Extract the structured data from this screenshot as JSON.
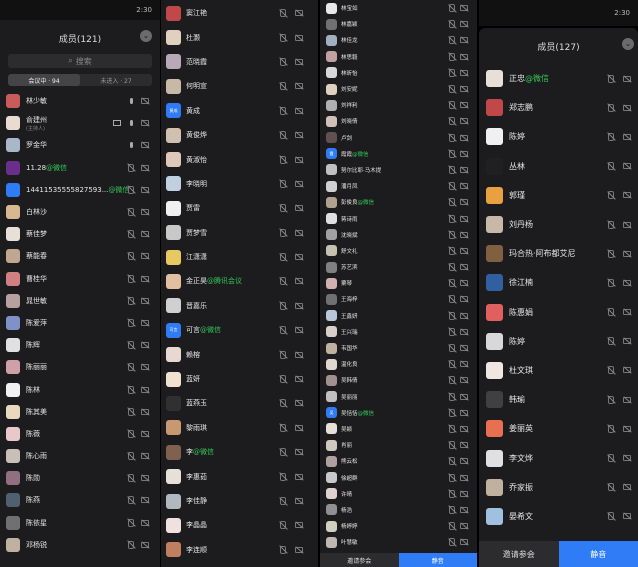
{
  "panel1": {
    "status_time": "2:30",
    "title": "成员(121)",
    "search_placeholder": "搜索",
    "tab_in_meeting": "会议中 · 94",
    "tab_not_joined": "未进入 · 27",
    "members": [
      {
        "name": "林少敏",
        "color": "#c95b5b",
        "mic": "mic-on"
      },
      {
        "name": "俞建州",
        "sub": "(主持人)",
        "color": "#e8dcd0",
        "mic": "mic-on",
        "screen": true
      },
      {
        "name": "罗金华",
        "color": "#a8b8c8",
        "mic": "mic-on"
      },
      {
        "name": "11.28",
        "tag": "@微信",
        "color": "#6a2f8a"
      },
      {
        "name": "14411535555827593...",
        "tag": "@微信",
        "color": "#2f7cf6"
      },
      {
        "name": "白林沙",
        "color": "#d8b890"
      },
      {
        "name": "蔡佳梦",
        "color": "#e8e0d8"
      },
      {
        "name": "蔡能春",
        "color": "#c0a890"
      },
      {
        "name": "曹桂华",
        "color": "#d08080"
      },
      {
        "name": "晁世敏",
        "color": "#b8a0a0"
      },
      {
        "name": "陈爱萍",
        "color": "#8090c8"
      },
      {
        "name": "陈辉",
        "color": "#e0e0e0"
      },
      {
        "name": "陈丽丽",
        "color": "#d0a0a8"
      },
      {
        "name": "陈林",
        "color": "#f0f0f0"
      },
      {
        "name": "陈其美",
        "color": "#e8d8c0"
      },
      {
        "name": "陈薇",
        "color": "#e8c8c8"
      },
      {
        "name": "陈心雨",
        "color": "#c8c0b8"
      },
      {
        "name": "陈勋",
        "color": "#907080"
      },
      {
        "name": "陈燕",
        "color": "#506070"
      },
      {
        "name": "陈依星",
        "color": "#707070"
      },
      {
        "name": "邓杨锐",
        "color": "#c0b0a0"
      }
    ]
  },
  "panel2": {
    "members": [
      {
        "name": "窦江艳",
        "color": "#c04848"
      },
      {
        "name": "杜灏",
        "color": "#e0d0c0"
      },
      {
        "name": "范晓霞",
        "color": "#b8a8b8"
      },
      {
        "name": "何明宣",
        "color": "#c8b8a8"
      },
      {
        "name": "黄成",
        "color": "#2f7cf6",
        "text": "黄成"
      },
      {
        "name": "黄俊烨",
        "color": "#d0c0b0"
      },
      {
        "name": "黄淑怡",
        "color": "#e0c8b8"
      },
      {
        "name": "李晓明",
        "color": "#c0d0e0"
      },
      {
        "name": "贾雷",
        "color": "#f0f0f0"
      },
      {
        "name": "贾梦雪",
        "color": "#c8c8c8"
      },
      {
        "name": "江潇潇",
        "color": "#e8c860"
      },
      {
        "name": "金正昊",
        "tag": "@腾讯会议",
        "color": "#e0c0a0"
      },
      {
        "name": "晋嘉乐",
        "color": "#d0d0d0"
      },
      {
        "name": "可言",
        "tag": "@微信",
        "color": "#2f7cf6",
        "text": "可言"
      },
      {
        "name": "赖榕",
        "color": "#e8d8d0"
      },
      {
        "name": "蓝妍",
        "color": "#f0e0d0"
      },
      {
        "name": "蓝燕玉",
        "color": "#303030"
      },
      {
        "name": "黎雨琪",
        "color": "#c89870"
      },
      {
        "name": "李",
        "tag": "@微信",
        "color": "#806050"
      },
      {
        "name": "李惠茹",
        "color": "#e8e0d8"
      },
      {
        "name": "李佳静",
        "color": "#b0b8c0"
      },
      {
        "name": "李晶晶",
        "color": "#f0e0e0"
      },
      {
        "name": "李连顺",
        "color": "#c08060"
      }
    ]
  },
  "panel3": {
    "members": [
      {
        "name": "林宝如",
        "color": "#e8e8e8"
      },
      {
        "name": "林嘉颖",
        "color": "#707070"
      },
      {
        "name": "林佳龙",
        "color": "#a0b0c0"
      },
      {
        "name": "林思毅",
        "color": "#c0a0a0"
      },
      {
        "name": "林昕怡",
        "color": "#d8d8d8"
      },
      {
        "name": "刘安妮",
        "color": "#e0d0c0"
      },
      {
        "name": "刘祥利",
        "color": "#b0b0b0"
      },
      {
        "name": "刘晓倩",
        "color": "#d0c0b8"
      },
      {
        "name": "卢剑",
        "color": "#605050"
      },
      {
        "name": "霞霞",
        "tag": "@微信",
        "color": "#2f7cf6",
        "text": "霞"
      },
      {
        "name": "努尔比耶·马木提",
        "color": "#c0c0c0"
      },
      {
        "name": "潘月凤",
        "color": "#d0d0d0"
      },
      {
        "name": "彭俊良",
        "tag": "@微信",
        "color": "#b0a090"
      },
      {
        "name": "蒋诗雨",
        "color": "#e0e0e0"
      },
      {
        "name": "沈晓斌",
        "color": "#a0a0a0"
      },
      {
        "name": "舒文礼",
        "color": "#c8c0b0"
      },
      {
        "name": "苏艺滨",
        "color": "#808080"
      },
      {
        "name": "粟琴",
        "color": "#d0b0b0"
      },
      {
        "name": "王海梓",
        "color": "#707070"
      },
      {
        "name": "王鑫妍",
        "color": "#b8c8d8"
      },
      {
        "name": "王兴瑞",
        "color": "#d8d0c8"
      },
      {
        "name": "韦国华",
        "color": "#c0b0a0"
      },
      {
        "name": "温化良",
        "color": "#e0d8d0"
      },
      {
        "name": "吴韩倩",
        "color": "#a09090"
      },
      {
        "name": "吴丽丽",
        "color": "#c0c0c0"
      },
      {
        "name": "吴恬恬",
        "tag": "@微信",
        "color": "#2f7cf6",
        "text": "吴"
      },
      {
        "name": "吴颖",
        "color": "#e8e0d8"
      },
      {
        "name": "肖丽",
        "color": "#d0c8c0"
      },
      {
        "name": "熊云松",
        "color": "#b0a0a0"
      },
      {
        "name": "徐超群",
        "color": "#c8c8c8"
      },
      {
        "name": "许晴",
        "color": "#e0d0d0"
      },
      {
        "name": "杨浩",
        "color": "#909090"
      },
      {
        "name": "杨婷婷",
        "color": "#d0d0c0"
      },
      {
        "name": "叶慧敏",
        "color": "#c0b8b0"
      }
    ],
    "invite_label": "邀请参会",
    "mute_label": "静音"
  },
  "panel4": {
    "status_time": "2:30",
    "title": "成员(127)",
    "members": [
      {
        "name": "正忠",
        "tag": "@微信",
        "color": "#e8e0d8"
      },
      {
        "name": "郑志鹏",
        "color": "#c04848"
      },
      {
        "name": "陈婷",
        "color": "#f0f0f0"
      },
      {
        "name": "丛林",
        "color": "#202020"
      },
      {
        "name": "郭瑾",
        "color": "#e8a040"
      },
      {
        "name": "刘丹杨",
        "color": "#c8b8a8"
      },
      {
        "name": "玛合热·阿布都艾尼",
        "color": "#806040"
      },
      {
        "name": "徐江楠",
        "color": "#3060a0"
      },
      {
        "name": "陈惠娟",
        "color": "#e06060"
      },
      {
        "name": "陈婷",
        "color": "#d8d8d8"
      },
      {
        "name": "杜文琪",
        "color": "#f0e8e0"
      },
      {
        "name": "韩瑜",
        "color": "#404040"
      },
      {
        "name": "姜丽英",
        "color": "#e87050"
      },
      {
        "name": "李文烨",
        "color": "#e0e0e0"
      },
      {
        "name": "乔家振",
        "color": "#c0b0a0"
      },
      {
        "name": "晏希文",
        "color": "#a0c0e0"
      }
    ],
    "invite_label": "邀请参会",
    "mute_label": "静音"
  }
}
